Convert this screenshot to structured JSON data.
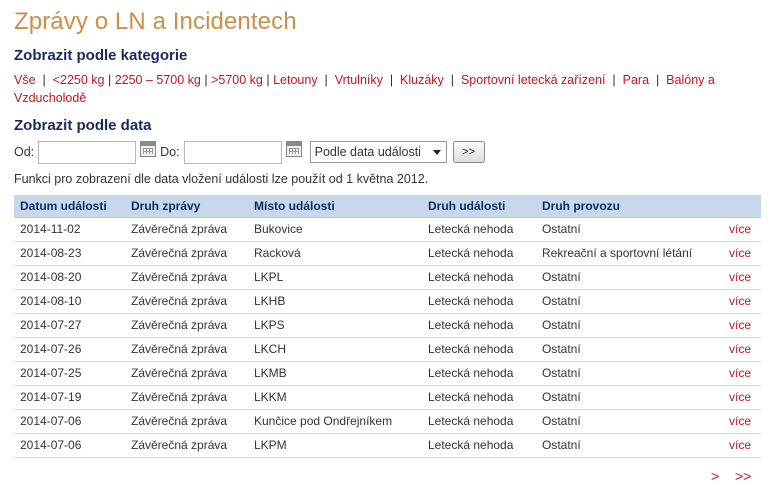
{
  "title": "Zprávy o LN a Incidentech",
  "category_section": {
    "heading": "Zobrazit podle kategorie",
    "items": [
      "Vše",
      "<2250 kg",
      "2250 – 5700 kg",
      ">5700 kg",
      "Letouny",
      "Vrtulníky",
      "Kluzáky",
      "Sportovní letecká zařízení",
      "Para",
      "Balóny a Vzducholodě"
    ]
  },
  "date_section": {
    "heading": "Zobrazit podle data",
    "from_label": "Od:",
    "to_label": "Do:",
    "from_value": "",
    "to_value": "",
    "sort_selected": "Podle data události",
    "go_label": ">>",
    "info": "Funkci pro zobrazení dle data vložení události lze použít od 1 května 2012."
  },
  "table": {
    "headers": [
      "Datum události",
      "Druh zprávy",
      "Místo události",
      "Druh události",
      "Druh provozu",
      ""
    ],
    "more_label": "více",
    "rows": [
      [
        "2014-11-02",
        "Závěrečná zpráva",
        "Bukovice",
        "Letecká nehoda",
        "Ostatní"
      ],
      [
        "2014-08-23",
        "Závěrečná zpráva",
        "Racková",
        "Letecká nehoda",
        "Rekreační a sportovní létání"
      ],
      [
        "2014-08-20",
        "Závěrečná zpráva",
        "LKPL",
        "Letecká nehoda",
        "Ostatní"
      ],
      [
        "2014-08-10",
        "Závěrečná zpráva",
        "LKHB",
        "Letecká nehoda",
        "Ostatní"
      ],
      [
        "2014-07-27",
        "Závěrečná zpráva",
        "LKPS",
        "Letecká nehoda",
        "Ostatní"
      ],
      [
        "2014-07-26",
        "Závěrečná zpráva",
        "LKCH",
        "Letecká nehoda",
        "Ostatní"
      ],
      [
        "2014-07-25",
        "Závěrečná zpráva",
        "LKMB",
        "Letecká nehoda",
        "Ostatní"
      ],
      [
        "2014-07-19",
        "Závěrečná zpráva",
        "LKKM",
        "Letecká nehoda",
        "Ostatní"
      ],
      [
        "2014-07-06",
        "Závěrečná zpráva",
        "Kunčice pod Ondřejníkem",
        "Letecká nehoda",
        "Ostatní"
      ],
      [
        "2014-07-06",
        "Závěrečná zpráva",
        "LKPM",
        "Letecká nehoda",
        "Ostatní"
      ]
    ]
  },
  "pager": {
    "next": ">",
    "last": ">>"
  },
  "colors": {
    "title": "#cc8f4a",
    "heading": "#1a2a5c",
    "link": "#c4151c",
    "table_header_bg": "#c9d7ec"
  },
  "icons": {
    "date_picker": "calendar-icon",
    "dropdown": "chevron-down-icon"
  }
}
